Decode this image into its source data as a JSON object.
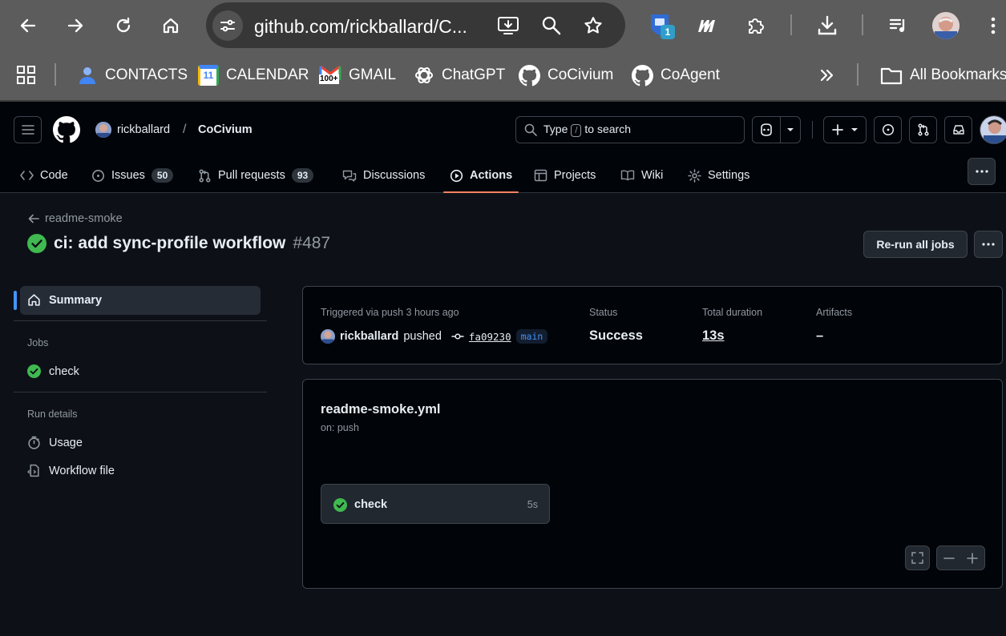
{
  "browser": {
    "url": "github.com/rickballard/C...",
    "extension_badge": "1",
    "bookmarks": [
      "CONTACTS",
      "CALENDAR",
      "GMAIL",
      "ChatGPT",
      "CoCivium",
      "CoAgent"
    ],
    "calendar_icon_text": "11",
    "gmail_icon_text": "100+",
    "all_bookmarks": "All Bookmarks"
  },
  "header": {
    "owner": "rickballard",
    "separator": "/",
    "repo": "CoCivium",
    "search_type": "Type",
    "search_key": "/",
    "search_rest": "to search"
  },
  "tabs": [
    {
      "label": "Code"
    },
    {
      "label": "Issues",
      "count": "50"
    },
    {
      "label": "Pull requests",
      "count": "93"
    },
    {
      "label": "Discussions"
    },
    {
      "label": "Actions"
    },
    {
      "label": "Projects"
    },
    {
      "label": "Wiki"
    },
    {
      "label": "Settings"
    }
  ],
  "run": {
    "back_label": "readme-smoke",
    "title": "ci: add sync-profile workflow",
    "number": "#487",
    "rerun_label": "Re-run all jobs"
  },
  "sidebar": {
    "summary": "Summary",
    "jobs_heading": "Jobs",
    "job": "check",
    "run_details_heading": "Run details",
    "usage": "Usage",
    "workflow_file": "Workflow file"
  },
  "summary_panel": {
    "trigger_label": "Triggered via push 3 hours ago",
    "actor": "rickballard",
    "action": "pushed",
    "commit": "fa09230",
    "branch": "main",
    "status_label": "Status",
    "status_value": "Success",
    "duration_label": "Total duration",
    "duration_value": "13s",
    "artifacts_label": "Artifacts",
    "artifacts_value": "–"
  },
  "workflow_panel": {
    "file": "readme-smoke.yml",
    "trigger": "on: push",
    "job_name": "check",
    "job_duration": "5s"
  },
  "colors": {
    "success": "#3fb950",
    "accent_tab": "#f78166",
    "link": "#4493f8"
  }
}
